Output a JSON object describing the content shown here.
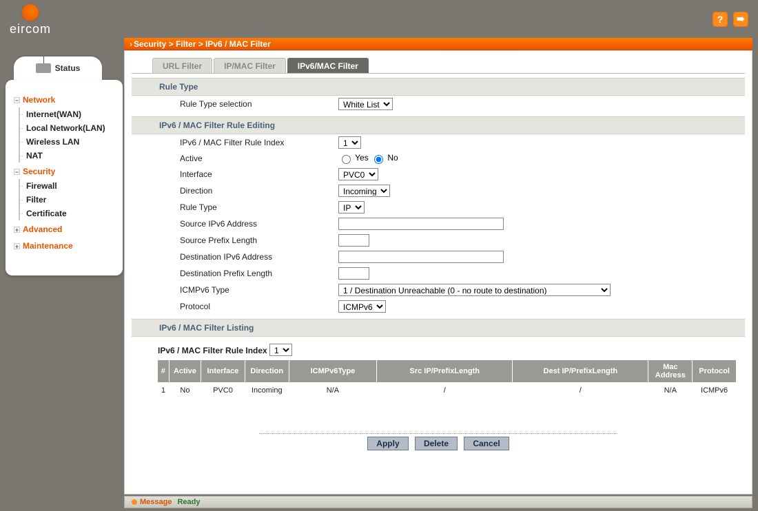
{
  "brand": "eircom",
  "breadcrumb": {
    "path": "Security > Filter > IPv6 / MAC Filter"
  },
  "topIcons": {
    "help": "?",
    "logout": "➠"
  },
  "statusTab": "Status",
  "sidebar": {
    "groups": [
      {
        "label": "Network",
        "expander": "−",
        "items": [
          "Internet(WAN)",
          "Local Network(LAN)",
          "Wireless LAN",
          "NAT"
        ]
      },
      {
        "label": "Security",
        "expander": "−",
        "items": [
          "Firewall",
          "Filter",
          "Certificate"
        ]
      },
      {
        "label": "Advanced",
        "expander": "+",
        "items": []
      },
      {
        "label": "Maintenance",
        "expander": "+",
        "items": []
      }
    ]
  },
  "tabs": {
    "t0": "URL Filter",
    "t1": "IP/MAC Filter",
    "t2": "IPv6/MAC Filter"
  },
  "sections": {
    "ruleType": "Rule Type",
    "editing": "IPv6 / MAC Filter Rule Editing",
    "listing": "IPv6 / MAC Filter Listing"
  },
  "form": {
    "ruleTypeSelLabel": "Rule Type selection",
    "ruleTypeSelValue": "White List",
    "ruleIndexLabel": "IPv6 / MAC Filter Rule Index",
    "ruleIndexValue": "1",
    "activeLabel": "Active",
    "activeYes": "Yes",
    "activeNo": "No",
    "activeSelected": "No",
    "interfaceLabel": "Interface",
    "interfaceValue": "PVC0",
    "directionLabel": "Direction",
    "directionValue": "Incoming",
    "innerRuleTypeLabel": "Rule Type",
    "innerRuleTypeValue": "IP",
    "srcIpLabel": "Source IPv6 Address",
    "srcIpValue": "",
    "srcPrefixLabel": "Source Prefix Length",
    "srcPrefixValue": "",
    "dstIpLabel": "Destination IPv6 Address",
    "dstIpValue": "",
    "dstPrefixLabel": "Destination Prefix Length",
    "dstPrefixValue": "",
    "icmpTypeLabel": "ICMPv6 Type",
    "icmpTypeValue": "1 / Destination Unreachable (0 - no route to destination)",
    "protocolLabel": "Protocol",
    "protocolValue": "ICMPv6"
  },
  "listing": {
    "title": "IPv6 / MAC Filter Rule Index",
    "indexValue": "1",
    "headers": [
      "#",
      "Active",
      "Interface",
      "Direction",
      "ICMPv6Type",
      "Src IP/PrefixLength",
      "Dest IP/PrefixLength",
      "Mac Address",
      "Protocol"
    ],
    "rows": [
      {
        "num": "1",
        "active": "No",
        "iface": "PVC0",
        "dir": "Incoming",
        "icmp": "N/A",
        "src": "/",
        "dst": "/",
        "mac": "N/A",
        "proto": "ICMPv6"
      }
    ]
  },
  "buttons": {
    "apply": "Apply",
    "delete": "Delete",
    "cancel": "Cancel"
  },
  "statusbar": {
    "label": "Message",
    "text": "Ready"
  }
}
